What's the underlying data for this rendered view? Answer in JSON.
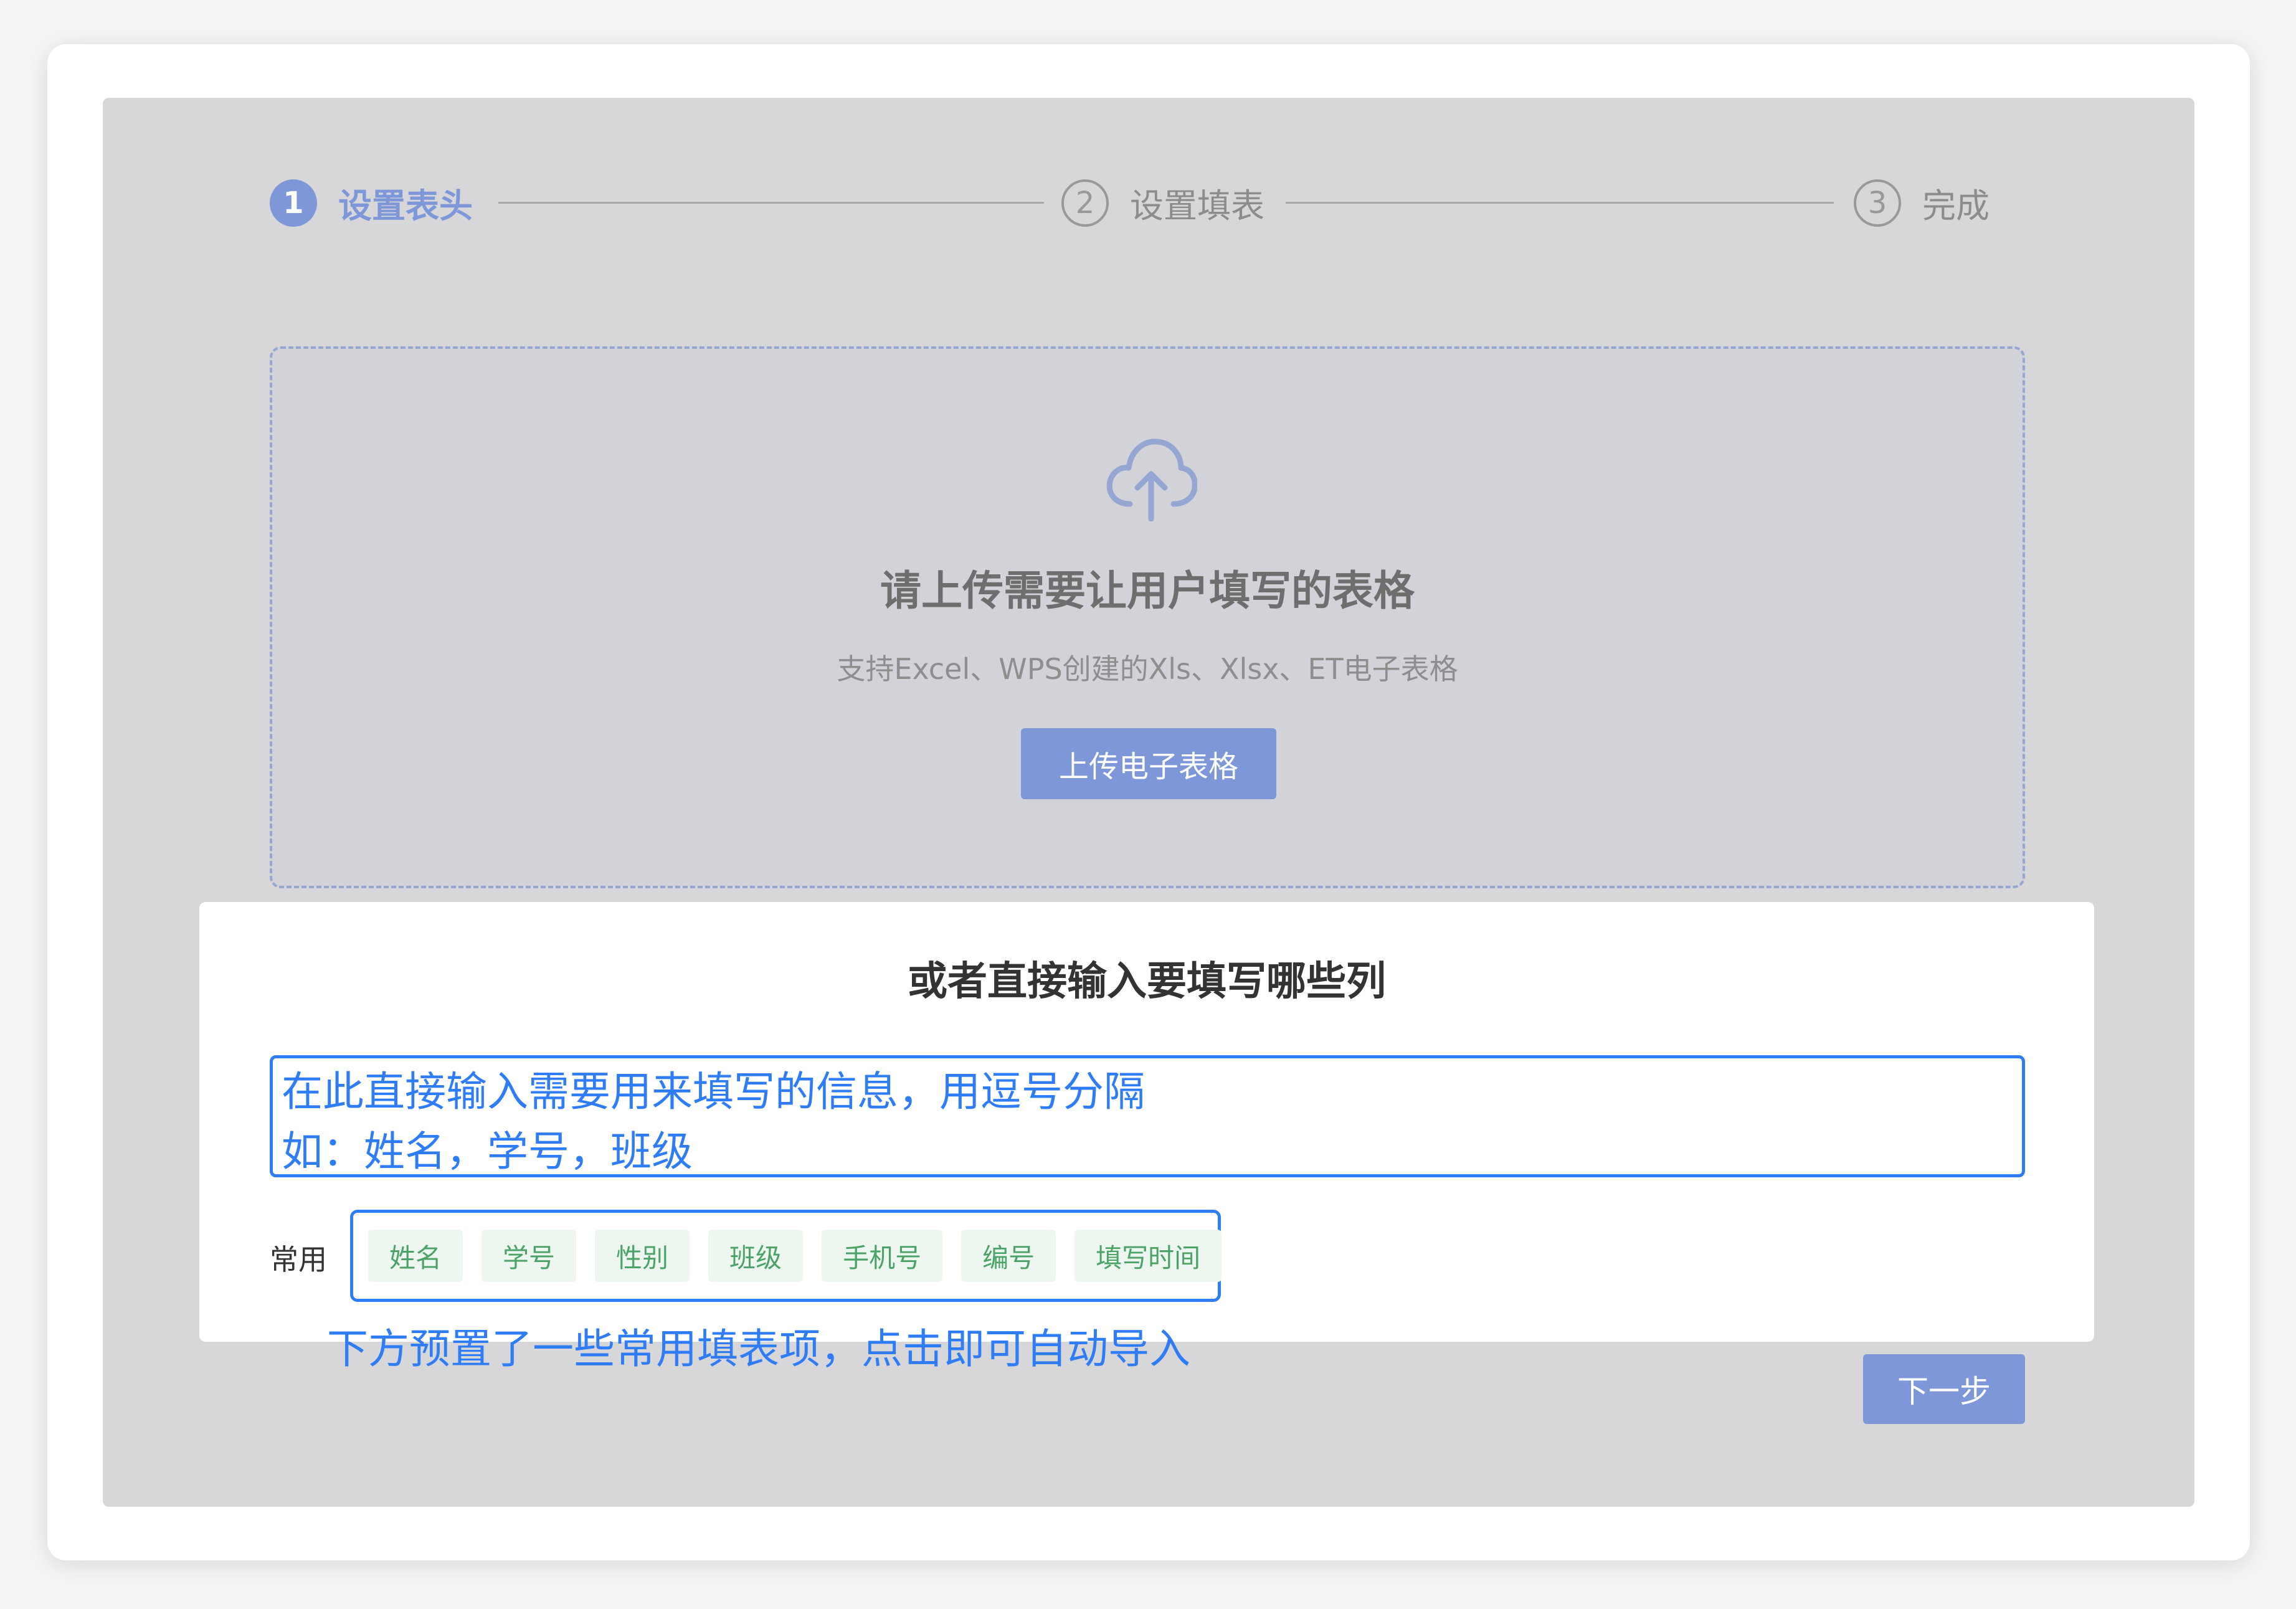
{
  "steps": [
    {
      "number": "1",
      "label": "设置表头"
    },
    {
      "number": "2",
      "label": "设置填表"
    },
    {
      "number": "3",
      "label": "完成"
    }
  ],
  "upload": {
    "icon": "cloud-upload-icon",
    "title": "请上传需要让用户填写的表格",
    "subtitle": "支持Excel、WPS创建的Xls、Xlsx、ET电子表格",
    "button_label": "上传电子表格"
  },
  "direct_input": {
    "title": "或者直接输入要填写哪些列",
    "placeholder": "在此直接输入需要用来填写的信息，用逗号分隔\n如：姓名，学号，班级",
    "common_label": "常用",
    "tags": [
      "姓名",
      "学号",
      "性别",
      "班级",
      "手机号",
      "编号",
      "填写时间"
    ],
    "annotation": "下方预置了一些常用填表项，点击即可自动导入"
  },
  "footer": {
    "next_label": "下一步"
  },
  "colors": {
    "accent": "#7d97d8",
    "highlight_blue": "#2e7cf6",
    "tag_text": "#4ba368",
    "tag_bg": "#eef6f0",
    "overlay": "#d7d7d9"
  }
}
